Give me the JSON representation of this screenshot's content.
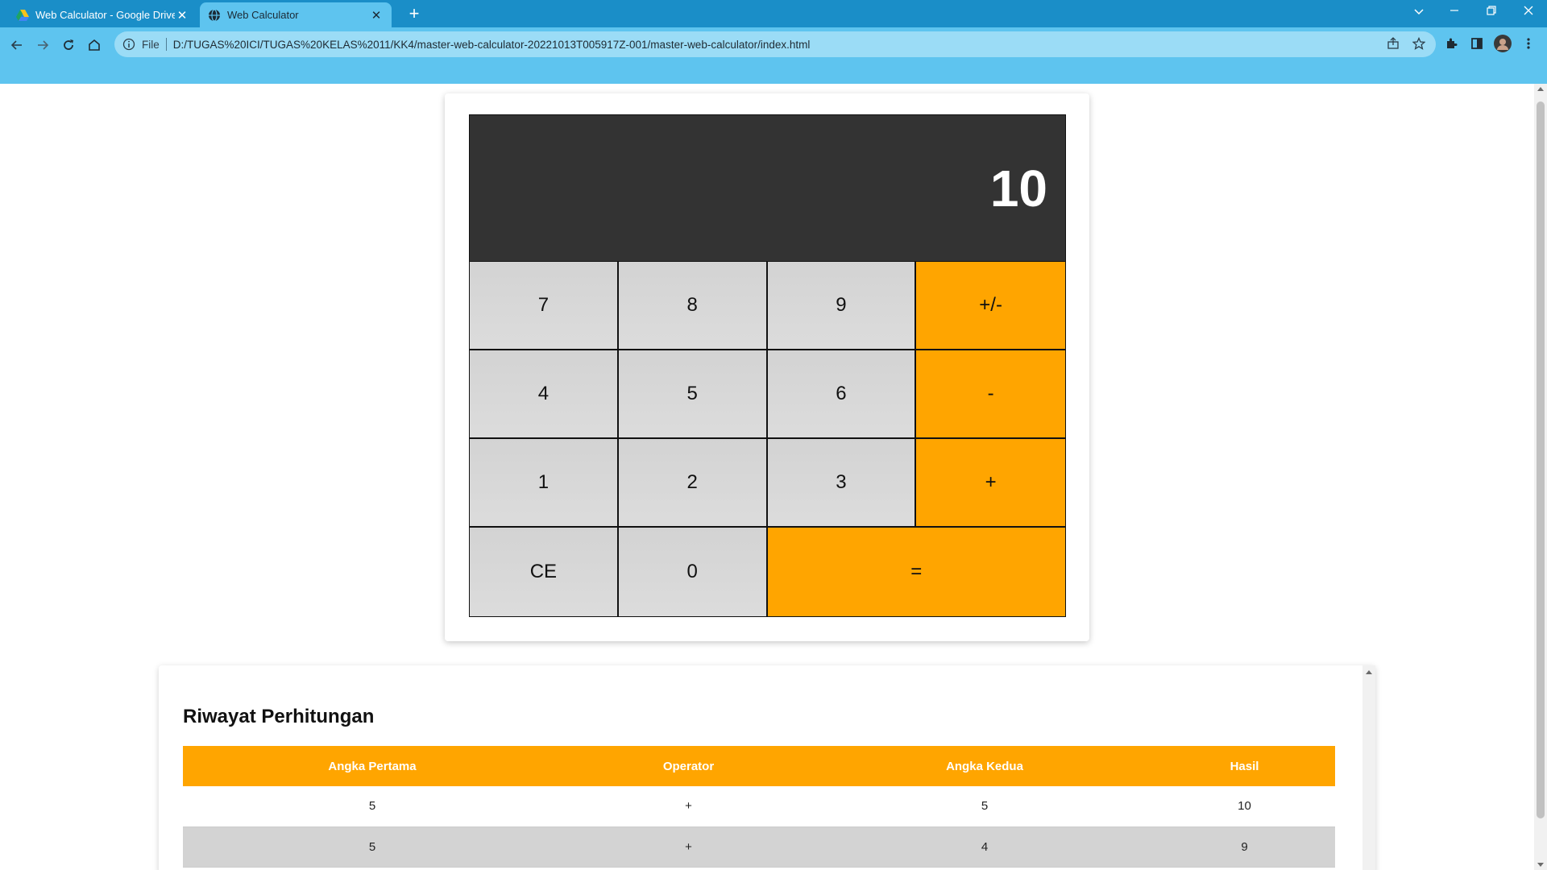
{
  "browser": {
    "tabs": [
      {
        "title": "Web Calculator - Google Drive",
        "active": false,
        "close": "✕"
      },
      {
        "title": "Web Calculator",
        "active": true,
        "close": "✕"
      }
    ],
    "new_tab": "+",
    "address": {
      "scheme": "File",
      "url": "D:/TUGAS%20ICI/TUGAS%20KELAS%2011/KK4/master-web-calculator-20221013T005917Z-001/master-web-calculator/index.html"
    },
    "colors": {
      "titlebar": "#1a8ec8",
      "toolbar": "#5ec4ef",
      "omnibox": "#9bdcf6"
    }
  },
  "calculator": {
    "display": "10",
    "keys": [
      {
        "label": "7",
        "type": "digit"
      },
      {
        "label": "8",
        "type": "digit"
      },
      {
        "label": "9",
        "type": "digit"
      },
      {
        "label": "+/-",
        "type": "operator"
      },
      {
        "label": "4",
        "type": "digit"
      },
      {
        "label": "5",
        "type": "digit"
      },
      {
        "label": "6",
        "type": "digit"
      },
      {
        "label": "-",
        "type": "operator"
      },
      {
        "label": "1",
        "type": "digit"
      },
      {
        "label": "2",
        "type": "digit"
      },
      {
        "label": "3",
        "type": "digit"
      },
      {
        "label": "+",
        "type": "operator"
      },
      {
        "label": "CE",
        "type": "clear"
      },
      {
        "label": "0",
        "type": "digit"
      },
      {
        "label": "=",
        "type": "equals"
      }
    ],
    "colors": {
      "display_bg": "#333333",
      "digit_bg": "#d3d3d3",
      "operator_bg": "#ffa500"
    }
  },
  "history": {
    "title": "Riwayat Perhitungan",
    "columns": [
      "Angka Pertama",
      "Operator",
      "Angka Kedua",
      "Hasil"
    ],
    "rows": [
      [
        "5",
        "+",
        "5",
        "10"
      ],
      [
        "5",
        "+",
        "4",
        "9"
      ]
    ]
  }
}
